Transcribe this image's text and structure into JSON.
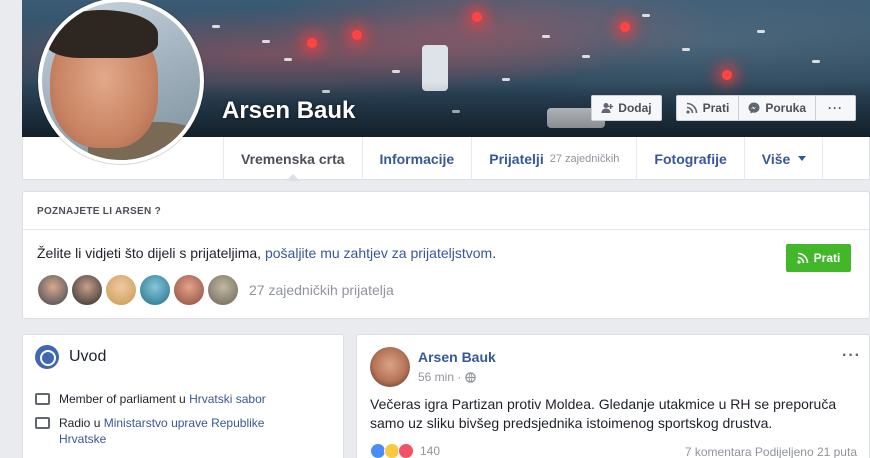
{
  "profile": {
    "name": "Arsen Bauk"
  },
  "cover_buttons": {
    "add": "Dodaj",
    "follow": "Prati",
    "message": "Poruka",
    "more": "···"
  },
  "nav": {
    "items": [
      {
        "label": "Vremenska crta",
        "sub": ""
      },
      {
        "label": "Informacije",
        "sub": ""
      },
      {
        "label": "Prijatelji",
        "sub": "27 zajedničkih"
      },
      {
        "label": "Fotografije",
        "sub": ""
      },
      {
        "label": "Više",
        "sub": ""
      }
    ]
  },
  "know_card": {
    "heading": "POZNAJETE LI ARSEN ?",
    "text_prefix": "Želite li vidjeti što dijeli s prijateljima,",
    "text_link": "pošaljite mu zahtjev za prijateljstvom",
    "text_suffix": ".",
    "follow": "Prati",
    "mutual_friends": "27 zajedničkih prijatelja"
  },
  "intro": {
    "title": "Uvod",
    "rows": [
      {
        "prefix": "Member of parliament u",
        "link": "Hrvatski sabor"
      },
      {
        "prefix": "Radio u",
        "link": "Ministarstvo uprave Republike Hrvatske"
      }
    ]
  },
  "post": {
    "author": "Arsen Bauk",
    "time": "56 min ·",
    "text": "Večeras igra Partizan protiv Moldea. Gledanje utakmice u RH se preporuča samo uz sliku bivšeg predsjednika istoimenog sportskog drustva.",
    "reactions_count": "140",
    "comments": "7 komentara",
    "shares": "Podijeljeno 21 puta",
    "more": "···"
  },
  "colors": {
    "link": "#365899",
    "green": "#42b72a",
    "background": "#e9ebee"
  }
}
